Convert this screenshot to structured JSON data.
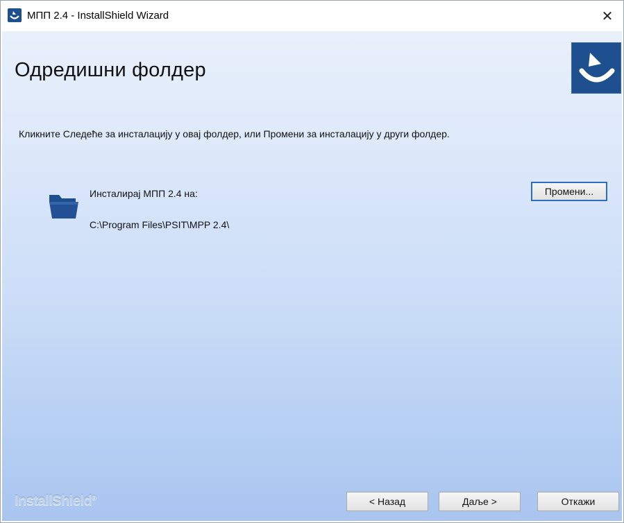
{
  "window": {
    "title": "МПП 2.4 - InstallShield Wizard",
    "close_glyph": "✕"
  },
  "header": {
    "title": "Одредишни фолдер",
    "logo_icon": "installshield-logo-icon"
  },
  "body": {
    "description": "Кликните Следеће за инсталацију у овај фолдер, или Промени за инсталацију у други фолдер.",
    "install_label": "Инсталирај МПП 2.4 на:",
    "install_path": "C:\\Program Files\\PSIT\\MPP 2.4\\",
    "change_button": "Промени..."
  },
  "footer": {
    "brand": "InstallShield",
    "brand_mark": "®",
    "back_button": "< Назад",
    "next_button": "Даље >",
    "cancel_button": "Откажи"
  },
  "colors": {
    "accent": "#1e4f8e",
    "focus_border": "#2b6fc4"
  }
}
